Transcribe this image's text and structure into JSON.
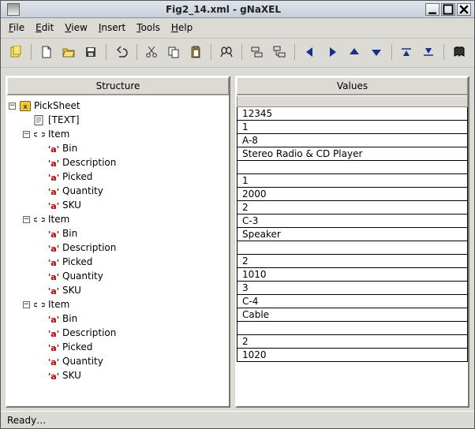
{
  "titlebar": {
    "title": "Fig2_14.xml  -  gNaXEL"
  },
  "menubar": {
    "items": [
      {
        "label": "File",
        "accel": "F"
      },
      {
        "label": "Edit",
        "accel": "E"
      },
      {
        "label": "View",
        "accel": "V"
      },
      {
        "label": "Insert",
        "accel": "I"
      },
      {
        "label": "Tools",
        "accel": "T"
      },
      {
        "label": "Help",
        "accel": "H"
      }
    ]
  },
  "panels": {
    "structure_title": "Structure",
    "values_title": "Values"
  },
  "tree": {
    "root": "PickSheet",
    "text_node": "[TEXT]",
    "items": [
      {
        "label": "Item",
        "children": [
          "Bin",
          "Description",
          "Picked",
          "Quantity",
          "SKU"
        ]
      },
      {
        "label": "Item",
        "children": [
          "Bin",
          "Description",
          "Picked",
          "Quantity",
          "SKU"
        ]
      },
      {
        "label": "Item",
        "children": [
          "Bin",
          "Description",
          "Picked",
          "Quantity",
          "SKU"
        ]
      }
    ]
  },
  "values": [
    "12345",
    "1",
    "A-8",
    "Stereo Radio & CD Player",
    "",
    "1",
    "2000",
    "2",
    "C-3",
    "Speaker",
    "",
    "2",
    "1010",
    "3",
    "C-4",
    "Cable",
    "",
    "2",
    "1020"
  ],
  "status": "Ready…"
}
